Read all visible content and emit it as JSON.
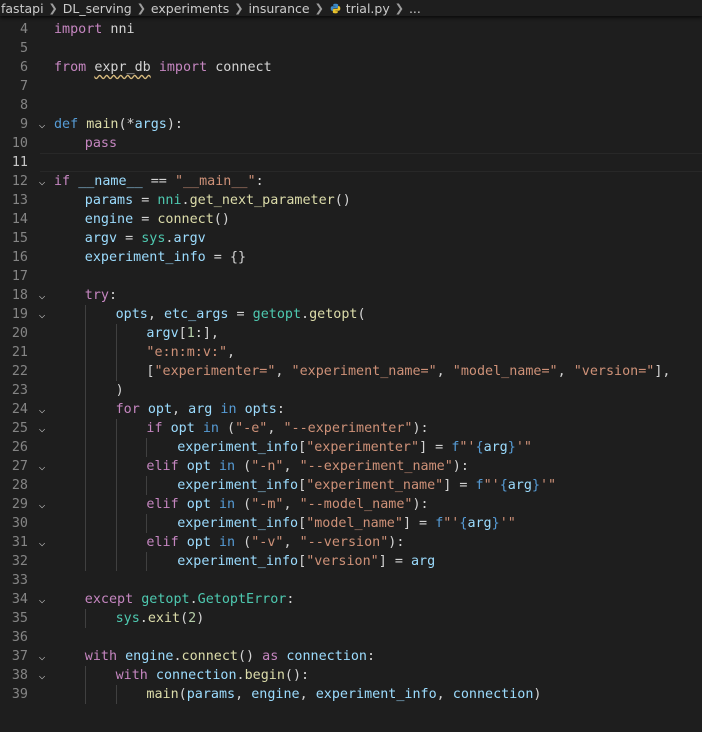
{
  "breadcrumb": {
    "items": [
      "fastapi",
      "DL_serving",
      "experiments",
      "insurance"
    ],
    "file": "trial.py",
    "ellipsis": "..."
  },
  "editor": {
    "current_line": 11,
    "lines": [
      {
        "n": 4,
        "fold": false,
        "indent": 0,
        "tokens": [
          [
            "c",
            "import"
          ],
          [
            "d",
            " nni"
          ]
        ]
      },
      {
        "n": 5,
        "fold": false,
        "indent": 0,
        "tokens": []
      },
      {
        "n": 6,
        "fold": false,
        "indent": 0,
        "tokens": [
          [
            "c",
            "from"
          ],
          [
            "d",
            " "
          ],
          [
            "sq",
            "expr_db"
          ],
          [
            "d",
            " "
          ],
          [
            "c",
            "import"
          ],
          [
            "d",
            " connect"
          ]
        ]
      },
      {
        "n": 7,
        "fold": false,
        "indent": 0,
        "tokens": []
      },
      {
        "n": 8,
        "fold": false,
        "indent": 0,
        "tokens": []
      },
      {
        "n": 9,
        "fold": true,
        "indent": 0,
        "tokens": [
          [
            "k",
            "def"
          ],
          [
            "d",
            " "
          ],
          [
            "f",
            "main"
          ],
          [
            "d",
            "(*"
          ],
          [
            "v",
            "args"
          ],
          [
            "d",
            "):"
          ]
        ]
      },
      {
        "n": 10,
        "fold": false,
        "indent": 1,
        "tokens": [
          [
            "c",
            "pass"
          ]
        ]
      },
      {
        "n": 11,
        "fold": false,
        "indent": 0,
        "tokens": []
      },
      {
        "n": 12,
        "fold": true,
        "indent": 0,
        "tokens": [
          [
            "c",
            "if"
          ],
          [
            "d",
            " "
          ],
          [
            "v",
            "__name__"
          ],
          [
            "d",
            " == "
          ],
          [
            "s",
            "\"__main__\""
          ],
          [
            "d",
            ":"
          ]
        ]
      },
      {
        "n": 13,
        "fold": false,
        "indent": 1,
        "tokens": [
          [
            "v",
            "params"
          ],
          [
            "d",
            " = "
          ],
          [
            "t",
            "nni"
          ],
          [
            "d",
            "."
          ],
          [
            "f",
            "get_next_parameter"
          ],
          [
            "d",
            "()"
          ]
        ]
      },
      {
        "n": 14,
        "fold": false,
        "indent": 1,
        "tokens": [
          [
            "v",
            "engine"
          ],
          [
            "d",
            " = "
          ],
          [
            "f",
            "connect"
          ],
          [
            "d",
            "()"
          ]
        ]
      },
      {
        "n": 15,
        "fold": false,
        "indent": 1,
        "tokens": [
          [
            "v",
            "argv"
          ],
          [
            "d",
            " = "
          ],
          [
            "t",
            "sys"
          ],
          [
            "d",
            "."
          ],
          [
            "v",
            "argv"
          ]
        ]
      },
      {
        "n": 16,
        "fold": false,
        "indent": 1,
        "tokens": [
          [
            "v",
            "experiment_info"
          ],
          [
            "d",
            " = {}"
          ]
        ]
      },
      {
        "n": 17,
        "fold": false,
        "indent": 1,
        "tokens": []
      },
      {
        "n": 18,
        "fold": true,
        "indent": 1,
        "tokens": [
          [
            "c",
            "try"
          ],
          [
            "d",
            ":"
          ]
        ]
      },
      {
        "n": 19,
        "fold": true,
        "indent": 2,
        "tokens": [
          [
            "v",
            "opts"
          ],
          [
            "d",
            ", "
          ],
          [
            "v",
            "etc_args"
          ],
          [
            "d",
            " = "
          ],
          [
            "t",
            "getopt"
          ],
          [
            "d",
            "."
          ],
          [
            "f",
            "getopt"
          ],
          [
            "d",
            "("
          ]
        ]
      },
      {
        "n": 20,
        "fold": false,
        "indent": 3,
        "tokens": [
          [
            "v",
            "argv"
          ],
          [
            "d",
            "["
          ],
          [
            "n",
            "1"
          ],
          [
            "d",
            ":],"
          ]
        ]
      },
      {
        "n": 21,
        "fold": false,
        "indent": 3,
        "tokens": [
          [
            "s",
            "\"e:n:m:v:\""
          ],
          [
            "d",
            ","
          ]
        ]
      },
      {
        "n": 22,
        "fold": false,
        "indent": 3,
        "tokens": [
          [
            "d",
            "["
          ],
          [
            "s",
            "\"experimenter=\""
          ],
          [
            "d",
            ", "
          ],
          [
            "s",
            "\"experiment_name=\""
          ],
          [
            "d",
            ", "
          ],
          [
            "s",
            "\"model_name=\""
          ],
          [
            "d",
            ", "
          ],
          [
            "s",
            "\"version=\""
          ],
          [
            "d",
            "],"
          ]
        ]
      },
      {
        "n": 23,
        "fold": false,
        "indent": 2,
        "tokens": [
          [
            "d",
            ")"
          ]
        ]
      },
      {
        "n": 24,
        "fold": true,
        "indent": 2,
        "tokens": [
          [
            "c",
            "for"
          ],
          [
            "d",
            " "
          ],
          [
            "v",
            "opt"
          ],
          [
            "d",
            ", "
          ],
          [
            "v",
            "arg"
          ],
          [
            "d",
            " "
          ],
          [
            "k",
            "in"
          ],
          [
            "d",
            " "
          ],
          [
            "v",
            "opts"
          ],
          [
            "d",
            ":"
          ]
        ]
      },
      {
        "n": 25,
        "fold": true,
        "indent": 3,
        "tokens": [
          [
            "c",
            "if"
          ],
          [
            "d",
            " "
          ],
          [
            "v",
            "opt"
          ],
          [
            "d",
            " "
          ],
          [
            "k",
            "in"
          ],
          [
            "d",
            " ("
          ],
          [
            "s",
            "\"-e\""
          ],
          [
            "d",
            ", "
          ],
          [
            "s",
            "\"--experimenter\""
          ],
          [
            "d",
            "):"
          ]
        ]
      },
      {
        "n": 26,
        "fold": false,
        "indent": 4,
        "tokens": [
          [
            "v",
            "experiment_info"
          ],
          [
            "d",
            "["
          ],
          [
            "s",
            "\"experimenter\""
          ],
          [
            "d",
            "] = "
          ],
          [
            "k",
            "f"
          ],
          [
            "s",
            "\"'"
          ],
          [
            "k",
            "{"
          ],
          [
            "v",
            "arg"
          ],
          [
            "k",
            "}"
          ],
          [
            "s",
            "'\""
          ]
        ]
      },
      {
        "n": 27,
        "fold": true,
        "indent": 3,
        "tokens": [
          [
            "c",
            "elif"
          ],
          [
            "d",
            " "
          ],
          [
            "v",
            "opt"
          ],
          [
            "d",
            " "
          ],
          [
            "k",
            "in"
          ],
          [
            "d",
            " ("
          ],
          [
            "s",
            "\"-n\""
          ],
          [
            "d",
            ", "
          ],
          [
            "s",
            "\"--experiment_name\""
          ],
          [
            "d",
            "):"
          ]
        ]
      },
      {
        "n": 28,
        "fold": false,
        "indent": 4,
        "tokens": [
          [
            "v",
            "experiment_info"
          ],
          [
            "d",
            "["
          ],
          [
            "s",
            "\"experiment_name\""
          ],
          [
            "d",
            "] = "
          ],
          [
            "k",
            "f"
          ],
          [
            "s",
            "\"'"
          ],
          [
            "k",
            "{"
          ],
          [
            "v",
            "arg"
          ],
          [
            "k",
            "}"
          ],
          [
            "s",
            "'\""
          ]
        ]
      },
      {
        "n": 29,
        "fold": true,
        "indent": 3,
        "tokens": [
          [
            "c",
            "elif"
          ],
          [
            "d",
            " "
          ],
          [
            "v",
            "opt"
          ],
          [
            "d",
            " "
          ],
          [
            "k",
            "in"
          ],
          [
            "d",
            " ("
          ],
          [
            "s",
            "\"-m\""
          ],
          [
            "d",
            ", "
          ],
          [
            "s",
            "\"--model_name\""
          ],
          [
            "d",
            "):"
          ]
        ]
      },
      {
        "n": 30,
        "fold": false,
        "indent": 4,
        "tokens": [
          [
            "v",
            "experiment_info"
          ],
          [
            "d",
            "["
          ],
          [
            "s",
            "\"model_name\""
          ],
          [
            "d",
            "] = "
          ],
          [
            "k",
            "f"
          ],
          [
            "s",
            "\"'"
          ],
          [
            "k",
            "{"
          ],
          [
            "v",
            "arg"
          ],
          [
            "k",
            "}"
          ],
          [
            "s",
            "'\""
          ]
        ]
      },
      {
        "n": 31,
        "fold": true,
        "indent": 3,
        "tokens": [
          [
            "c",
            "elif"
          ],
          [
            "d",
            " "
          ],
          [
            "v",
            "opt"
          ],
          [
            "d",
            " "
          ],
          [
            "k",
            "in"
          ],
          [
            "d",
            " ("
          ],
          [
            "s",
            "\"-v\""
          ],
          [
            "d",
            ", "
          ],
          [
            "s",
            "\"--version\""
          ],
          [
            "d",
            "):"
          ]
        ]
      },
      {
        "n": 32,
        "fold": false,
        "indent": 4,
        "tokens": [
          [
            "v",
            "experiment_info"
          ],
          [
            "d",
            "["
          ],
          [
            "s",
            "\"version\""
          ],
          [
            "d",
            "] = "
          ],
          [
            "v",
            "arg"
          ]
        ]
      },
      {
        "n": 33,
        "fold": false,
        "indent": 1,
        "tokens": []
      },
      {
        "n": 34,
        "fold": true,
        "indent": 1,
        "tokens": [
          [
            "c",
            "except"
          ],
          [
            "d",
            " "
          ],
          [
            "t",
            "getopt"
          ],
          [
            "d",
            "."
          ],
          [
            "t",
            "GetoptError"
          ],
          [
            "d",
            ":"
          ]
        ]
      },
      {
        "n": 35,
        "fold": false,
        "indent": 2,
        "tokens": [
          [
            "t",
            "sys"
          ],
          [
            "d",
            "."
          ],
          [
            "f",
            "exit"
          ],
          [
            "d",
            "("
          ],
          [
            "n",
            "2"
          ],
          [
            "d",
            ")"
          ]
        ]
      },
      {
        "n": 36,
        "fold": false,
        "indent": 1,
        "tokens": []
      },
      {
        "n": 37,
        "fold": true,
        "indent": 1,
        "tokens": [
          [
            "c",
            "with"
          ],
          [
            "d",
            " "
          ],
          [
            "v",
            "engine"
          ],
          [
            "d",
            "."
          ],
          [
            "f",
            "connect"
          ],
          [
            "d",
            "() "
          ],
          [
            "c",
            "as"
          ],
          [
            "d",
            " "
          ],
          [
            "v",
            "connection"
          ],
          [
            "d",
            ":"
          ]
        ]
      },
      {
        "n": 38,
        "fold": true,
        "indent": 2,
        "tokens": [
          [
            "c",
            "with"
          ],
          [
            "d",
            " "
          ],
          [
            "v",
            "connection"
          ],
          [
            "d",
            "."
          ],
          [
            "f",
            "begin"
          ],
          [
            "d",
            "():"
          ]
        ]
      },
      {
        "n": 39,
        "fold": false,
        "indent": 3,
        "tokens": [
          [
            "f",
            "main"
          ],
          [
            "d",
            "("
          ],
          [
            "v",
            "params"
          ],
          [
            "d",
            ", "
          ],
          [
            "v",
            "engine"
          ],
          [
            "d",
            ", "
          ],
          [
            "v",
            "experiment_info"
          ],
          [
            "d",
            ", "
          ],
          [
            "v",
            "connection"
          ],
          [
            "d",
            ")"
          ]
        ]
      }
    ]
  }
}
